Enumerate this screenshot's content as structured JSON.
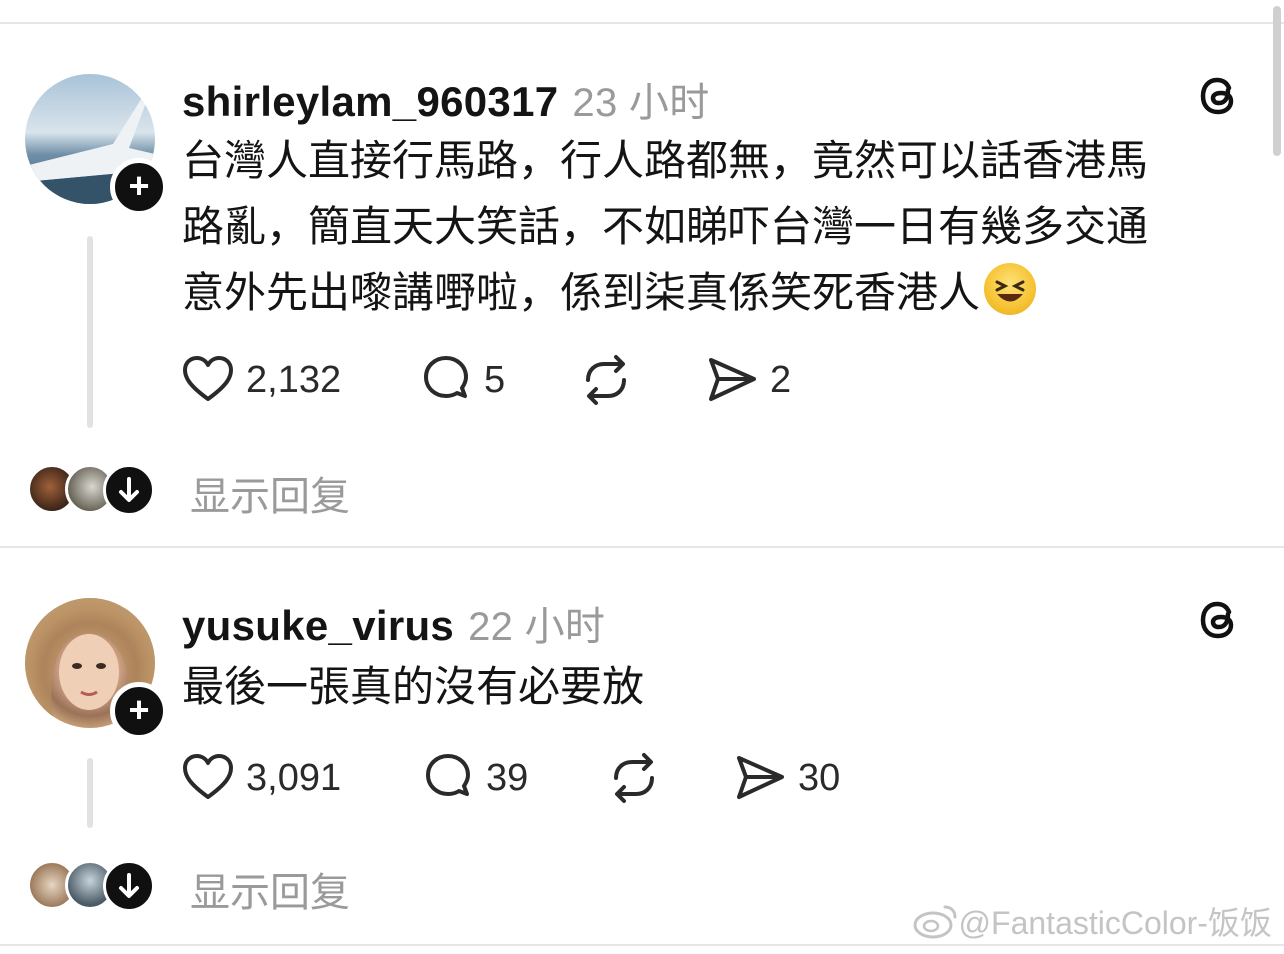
{
  "posts": [
    {
      "username": "shirleylam_960317",
      "time": "23 小时",
      "text": "台灣人直接行馬路，行人路都無，竟然可以話香港馬\n路亂，簡直天大笑話，不如睇吓台灣一日有幾多交通\n意外先出嚟講嘢啦，係到柒真係笑死香港人",
      "emoji": "laughing-emoji",
      "likes": "2,132",
      "comments": "5",
      "shares": "2",
      "show_replies": "显示回复"
    },
    {
      "username": "yusuke_virus",
      "time": "22 小时",
      "text": "最後一張真的沒有必要放",
      "likes": "3,091",
      "comments": "39",
      "shares": "30",
      "show_replies": "显示回复"
    }
  ],
  "watermark": "@FantasticColor-饭饭",
  "icons": {
    "like": "heart-icon",
    "comment": "comment-bubble-icon",
    "repost": "repost-icon",
    "share": "send-icon",
    "brand": "threads-logo-icon",
    "follow": "plus-icon",
    "expand": "arrow-down-icon"
  },
  "colors": {
    "text": "#141414",
    "muted": "#9a9a9a",
    "divider": "#e6e6e6",
    "badge": "#101010"
  }
}
